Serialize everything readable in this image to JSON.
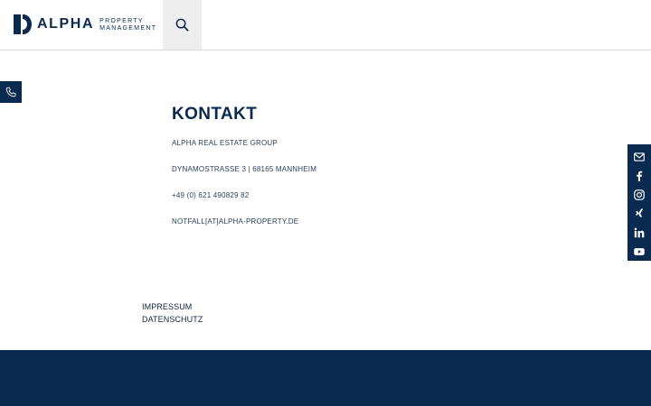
{
  "header": {
    "logo_word": "ALPHA",
    "logo_sub_line1": "PROPERTY",
    "logo_sub_line2": "MANAGEMENT",
    "search_icon": "search-icon"
  },
  "side_tab": {
    "icon": "phone-icon"
  },
  "social": {
    "icons": [
      "mail-icon",
      "facebook-icon",
      "instagram-icon",
      "xing-icon",
      "linkedin-icon",
      "youtube-icon"
    ]
  },
  "contact": {
    "title": "KONTAKT",
    "company": "ALPHA REAL ESTATE GROUP",
    "address": "DYNAMOSTRASSE 3 | 68165 MANNHEIM",
    "phone": "+49 (0) 621 490829 82",
    "email": "NOTFALL[AT]ALPHA-PROPERTY.DE"
  },
  "footer": {
    "impressum": "IMPRESSUM",
    "datenschutz": "DATENSCHUTZ"
  },
  "colors": {
    "brand_navy": "#0a2a50",
    "search_bg": "#eeeeee",
    "background": "#ffffff"
  }
}
